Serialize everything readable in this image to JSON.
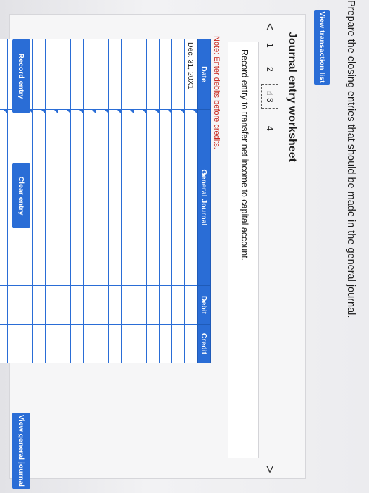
{
  "instruction": "Prepare the closing entries that should be made in the general journal.",
  "toolbar": {
    "view_transactions_label": "View transaction list"
  },
  "worksheet": {
    "title": "Journal entry worksheet",
    "pager": {
      "prev_icon": "<",
      "next_icon": ">",
      "pages": [
        "1",
        "2",
        "3",
        "4"
      ],
      "active_page": "3"
    },
    "entry_description": "Record entry to transfer net income to capital account.",
    "note": "Note: Enter debits before credits."
  },
  "table": {
    "headers": {
      "date": "Date",
      "general_journal": "General Journal",
      "debit": "Debit",
      "credit": "Credit"
    },
    "rows": [
      {
        "date": "Dec. 31, 20X1",
        "account": "",
        "debit": "",
        "credit": ""
      },
      {
        "date": "",
        "account": "",
        "debit": "",
        "credit": ""
      },
      {
        "date": "",
        "account": "",
        "debit": "",
        "credit": ""
      },
      {
        "date": "",
        "account": "",
        "debit": "",
        "credit": ""
      },
      {
        "date": "",
        "account": "",
        "debit": "",
        "credit": ""
      },
      {
        "date": "",
        "account": "",
        "debit": "",
        "credit": ""
      },
      {
        "date": "",
        "account": "",
        "debit": "",
        "credit": ""
      },
      {
        "date": "",
        "account": "",
        "debit": "",
        "credit": ""
      },
      {
        "date": "",
        "account": "",
        "debit": "",
        "credit": ""
      },
      {
        "date": "",
        "account": "",
        "debit": "",
        "credit": ""
      },
      {
        "date": "",
        "account": "",
        "debit": "",
        "credit": ""
      },
      {
        "date": "",
        "account": "",
        "debit": "",
        "credit": ""
      },
      {
        "date": "",
        "account": "",
        "debit": "",
        "credit": ""
      },
      {
        "date": "",
        "account": "",
        "debit": "",
        "credit": ""
      },
      {
        "date": "",
        "account": "",
        "debit": "",
        "credit": ""
      },
      {
        "date": "",
        "account": "",
        "debit": "",
        "credit": ""
      },
      {
        "date": "",
        "account": "",
        "debit": "",
        "credit": ""
      },
      {
        "date": "",
        "account": "",
        "debit": "",
        "credit": ""
      },
      {
        "date": "",
        "account": "",
        "debit": "",
        "credit": ""
      }
    ]
  },
  "actions": {
    "record_label": "Record entry",
    "clear_label": "Clear entry",
    "view_journal_label": "View general journal"
  },
  "icons": {
    "active_page_icon": "hand-pointer-icon"
  },
  "colors": {
    "accent": "#2a6dd6",
    "note_red": "#c8281f"
  }
}
